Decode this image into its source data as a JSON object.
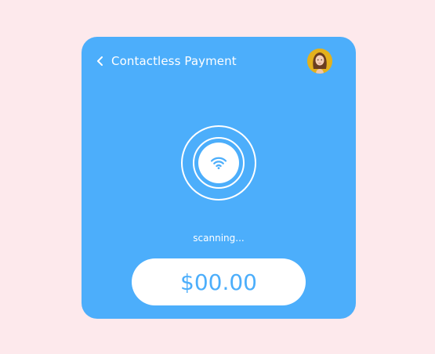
{
  "header": {
    "back_icon": "chevron-left-icon",
    "title": "Contactless Payment"
  },
  "avatar": {
    "icon": "user-avatar"
  },
  "scanner": {
    "icon": "wifi-icon"
  },
  "status": {
    "text": "scanning..."
  },
  "payment": {
    "amount": "$00.00"
  },
  "colors": {
    "background": "#fde9ec",
    "card": "#4caefb",
    "surface": "#ffffff",
    "avatar_bg": "#e3b11d"
  }
}
